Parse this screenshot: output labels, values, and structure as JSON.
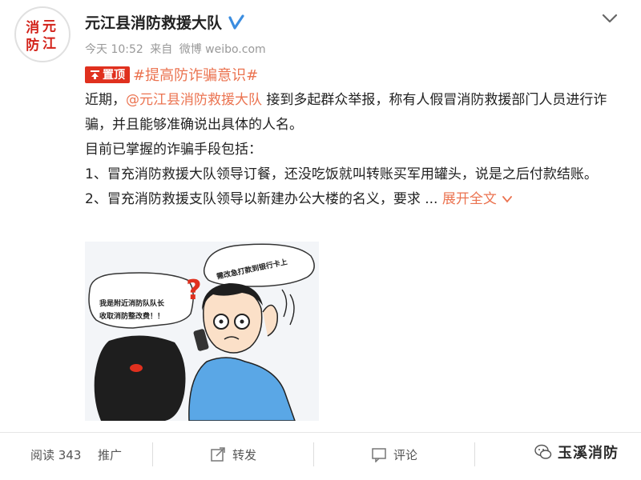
{
  "header": {
    "user_name": "元江县消防救援大队",
    "avatar_text": "消元防江",
    "time": "今天 10:52",
    "source_prefix": "来自",
    "source": "微博 weibo.com"
  },
  "topic": {
    "pin_label": "置顶",
    "hashtag": "#提高防诈骗意识#"
  },
  "content": {
    "line1_prefix": "近期，",
    "mention": "@元江县消防救援大队",
    "line1_suffix": "接到多起群众举报，称有人假冒消防救援部门人员进行诈骗，并且能够准确说出具体的人名。",
    "line2": "目前已掌握的诈骗手段包括：",
    "line3": "1、冒充消防救援大队领导订餐，还没吃饭就叫转账买军用罐头，说是之后付款结账。",
    "line4": "2、冒充消防救援支队领导以新建办公大楼的名义，要求 ...",
    "expand_label": "展开全文"
  },
  "image": {
    "bubble_left_line1": "我是附近消防队队长",
    "bubble_left_line2": "收取消防整改费！！",
    "bubble_right": "需改急打款到银行卡上",
    "question_mark": "?"
  },
  "footer": {
    "read_label": "阅读 343",
    "promo_label": "推广",
    "share_label": "转发",
    "comment_label": "评论"
  },
  "watermark": {
    "text": "玉溪消防"
  },
  "colors": {
    "accent": "#eb7350",
    "pin_red": "#e0301e",
    "verified_blue": "#3b8de0"
  }
}
